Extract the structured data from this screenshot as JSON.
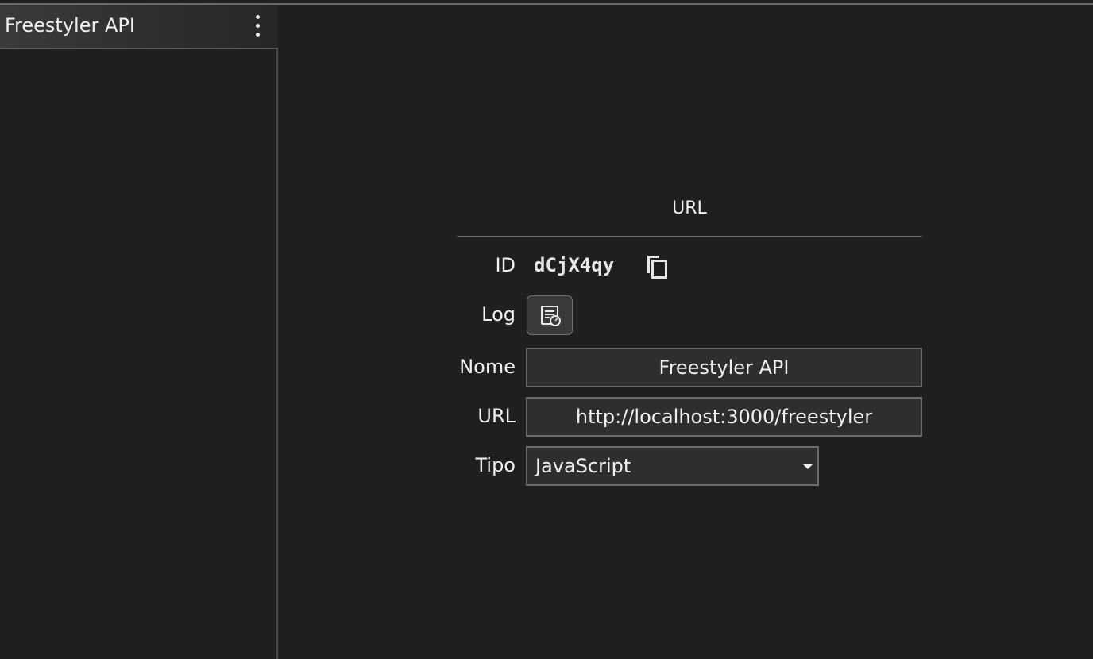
{
  "sidebar": {
    "title": "Freestyler API",
    "menu_icon": "kebab-menu-icon"
  },
  "section": {
    "title": "URL"
  },
  "form": {
    "id_label": "ID",
    "id_value": "dCjX4qy",
    "copy_icon": "copy-icon",
    "log_label": "Log",
    "log_icon": "log-document-icon",
    "name_label": "Nome",
    "name_value": "Freestyler API",
    "url_label": "URL",
    "url_value": "http://localhost:3000/freestyler",
    "type_label": "Tipo",
    "type_value": "JavaScript"
  },
  "colors": {
    "background": "#1f1f1f",
    "field_background": "#2e2e2e",
    "border": "#6c6c6c",
    "text": "#f0f0f0"
  }
}
